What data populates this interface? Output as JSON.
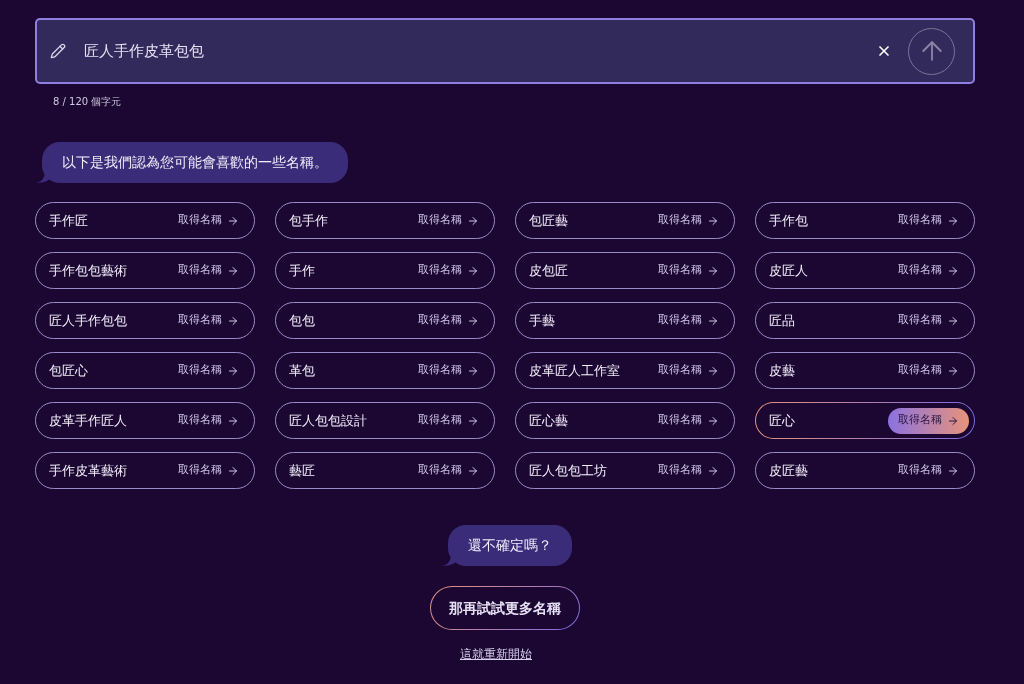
{
  "name_input": {
    "value": "匠人手作皮革包包",
    "char_count": "8 / 120 個字元"
  },
  "intro_message": "以下是我們認為您可能會喜歡的一些名稱。",
  "suggestions": [
    {
      "name": "手作匠",
      "action": "取得名稱",
      "selected": false
    },
    {
      "name": "包手作",
      "action": "取得名稱",
      "selected": false
    },
    {
      "name": "包匠藝",
      "action": "取得名稱",
      "selected": false
    },
    {
      "name": "手作包",
      "action": "取得名稱",
      "selected": false
    },
    {
      "name": "手作包包藝術",
      "action": "取得名稱",
      "selected": false
    },
    {
      "name": "手作",
      "action": "取得名稱",
      "selected": false
    },
    {
      "name": "皮包匠",
      "action": "取得名稱",
      "selected": false
    },
    {
      "name": "皮匠人",
      "action": "取得名稱",
      "selected": false
    },
    {
      "name": "匠人手作包包",
      "action": "取得名稱",
      "selected": false
    },
    {
      "name": "包包",
      "action": "取得名稱",
      "selected": false
    },
    {
      "name": "手藝",
      "action": "取得名稱",
      "selected": false
    },
    {
      "name": "匠品",
      "action": "取得名稱",
      "selected": false
    },
    {
      "name": "包匠心",
      "action": "取得名稱",
      "selected": false
    },
    {
      "name": "革包",
      "action": "取得名稱",
      "selected": false
    },
    {
      "name": "皮革匠人工作室",
      "action": "取得名稱",
      "selected": false
    },
    {
      "name": "皮藝",
      "action": "取得名稱",
      "selected": false
    },
    {
      "name": "皮革手作匠人",
      "action": "取得名稱",
      "selected": false
    },
    {
      "name": "匠人包包設計",
      "action": "取得名稱",
      "selected": false
    },
    {
      "name": "匠心藝",
      "action": "取得名稱",
      "selected": false
    },
    {
      "name": "匠心",
      "action": "取得名稱",
      "selected": true
    },
    {
      "name": "手作皮革藝術",
      "action": "取得名稱",
      "selected": false
    },
    {
      "name": "藝匠",
      "action": "取得名稱",
      "selected": false
    },
    {
      "name": "匠人包包工坊",
      "action": "取得名稱",
      "selected": false
    },
    {
      "name": "皮匠藝",
      "action": "取得名稱",
      "selected": false
    }
  ],
  "followup_message": "還不確定嗎？",
  "more_button": "那再試試更多名稱",
  "restart_link": "這就重新開始"
}
